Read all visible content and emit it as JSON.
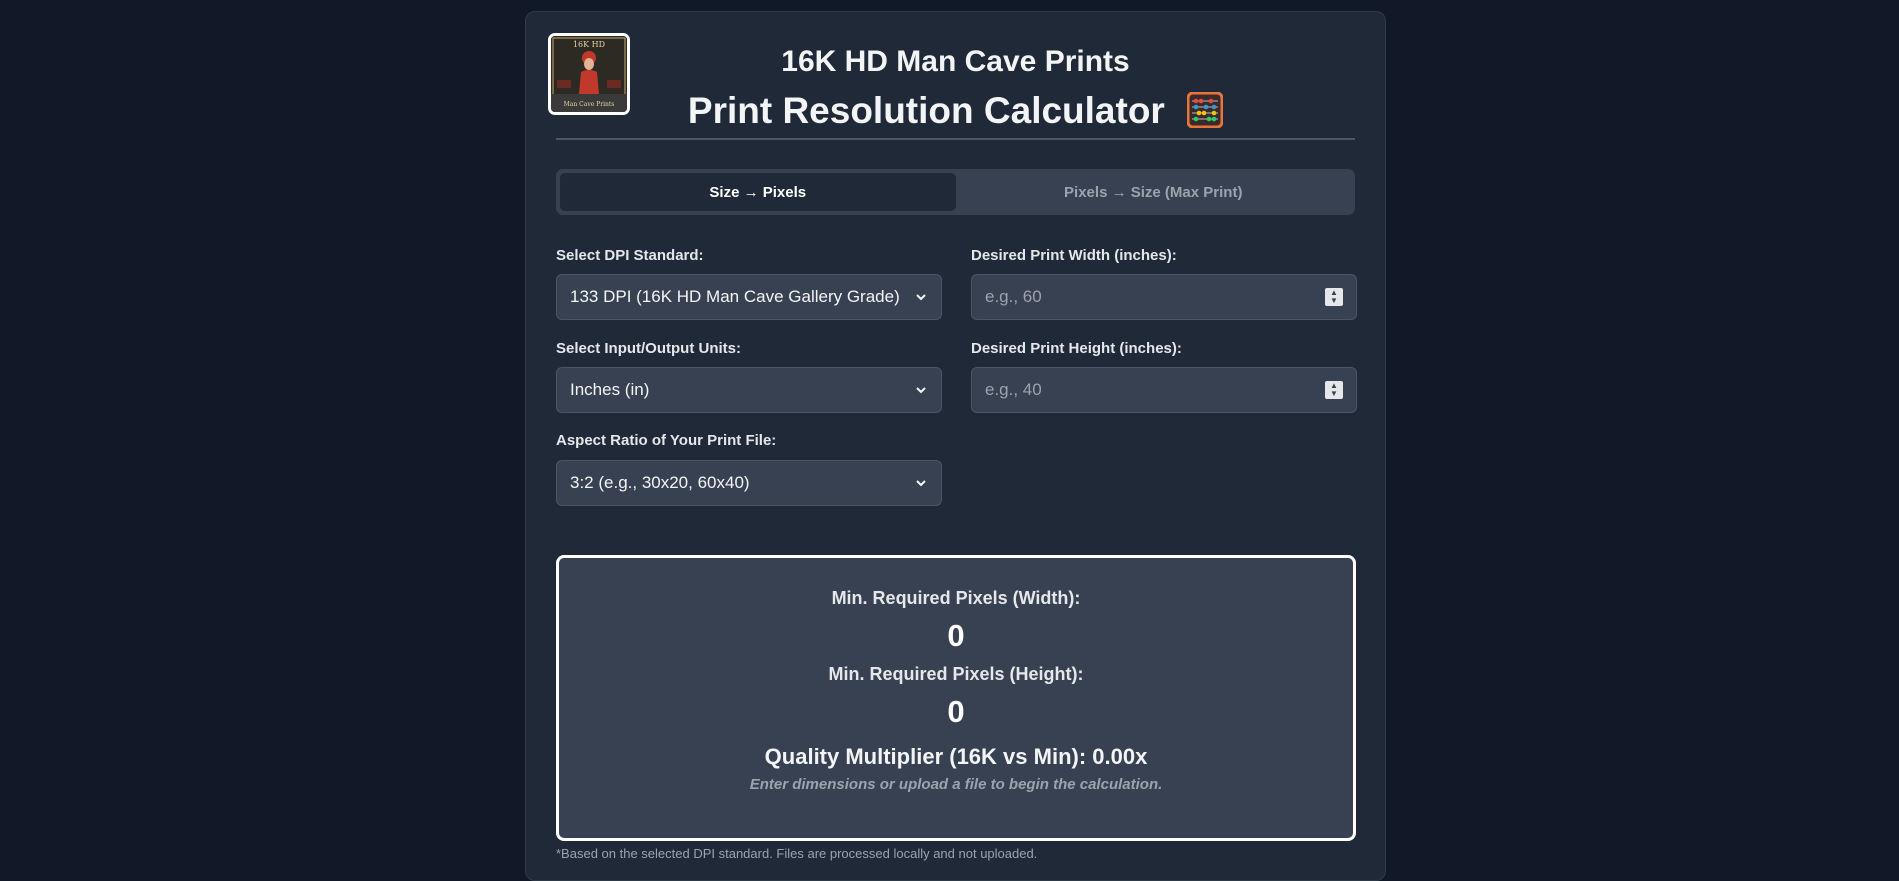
{
  "header": {
    "brand": "16K HD Man Cave Prints",
    "title": "Print Resolution Calculator",
    "logo_text_top": "16K HD",
    "logo_text_bottom": "Man Cave Prints"
  },
  "tabs": [
    {
      "label": "Size → Pixels",
      "active": true
    },
    {
      "label": "Pixels → Size (Max Print)",
      "active": false
    }
  ],
  "form": {
    "dpi_label": "Select DPI Standard:",
    "dpi_value": "133 DPI (16K HD Man Cave Gallery Grade)",
    "units_label": "Select Input/Output Units:",
    "units_value": "Inches (in)",
    "aspect_label": "Aspect Ratio of Your Print File:",
    "aspect_value": "3:2 (e.g., 30x20, 60x40)",
    "width_label": "Desired Print Width (inches):",
    "width_placeholder": "e.g., 60",
    "height_label": "Desired Print Height (inches):",
    "height_placeholder": "e.g., 40"
  },
  "results": {
    "width_label": "Min. Required Pixels (Width):",
    "width_value": "0",
    "height_label": "Min. Required Pixels (Height):",
    "height_value": "0",
    "quality": "Quality Multiplier (16K vs Min): 0.00x",
    "hint": "Enter dimensions or upload a file to begin the calculation."
  },
  "footer_note": "*Based on the selected DPI standard. Files are processed locally and not uploaded.",
  "colors": {
    "page_bg": "#111827",
    "card_bg": "#1f2937",
    "field_bg": "#374151",
    "text": "#f3f4f6",
    "muted": "#9ca3af"
  },
  "icons": [
    "abacus-icon",
    "chevron-down-icon",
    "spinner-icon"
  ]
}
